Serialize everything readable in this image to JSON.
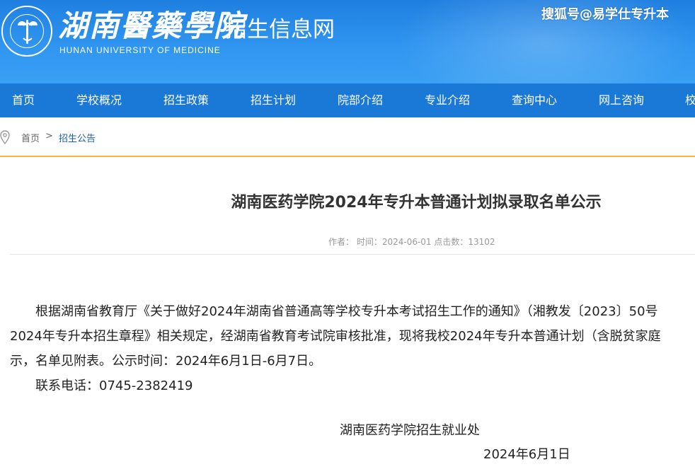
{
  "header": {
    "school_name": "湖南醫藥學院",
    "school_name_en": "HUNAN UNIVERSITY OF MEDICINE",
    "site_name": "招生信息网",
    "watermark": "搜狐号@易学仕专升本",
    "emblem_icon": "caduceus-emblem-icon"
  },
  "colors": {
    "header_blue": "#2f95f0",
    "nav_blue": "#1a78d6",
    "accent_orange": "#f2b83a",
    "breadcrumb_link": "#1a5fa8"
  },
  "nav": {
    "items": [
      "首页",
      "学校概况",
      "招生政策",
      "招生计划",
      "院部介绍",
      "专业介绍",
      "查询中心",
      "网上咨询",
      "校"
    ]
  },
  "breadcrumb": {
    "icon": "location-pin-icon",
    "home": "首页",
    "separator": ">",
    "current": "招生公告"
  },
  "article": {
    "title": "湖南医药学院2024年专升本普通计划拟录取名单公示",
    "meta": "作者：  时间：2024-06-01 点击数：13102",
    "paragraphs": [
      "根据湖南省教育厅《关于做好2024年湖南省普通高等学校专升本考试招生工作的通知》（湘教发〔2023〕50号",
      "2024年专升本招生章程》相关规定，经湖南省教育考试院审核批准，现将我校2024年专升本普通计划（含脱贫家庭",
      "示，名单见附表。公示时间：2024年6月1日-6月7日。",
      "联系电话：0745-2382419"
    ],
    "signature_org": "湖南医药学院招生就业处",
    "signature_date": "2024年6月1日"
  }
}
